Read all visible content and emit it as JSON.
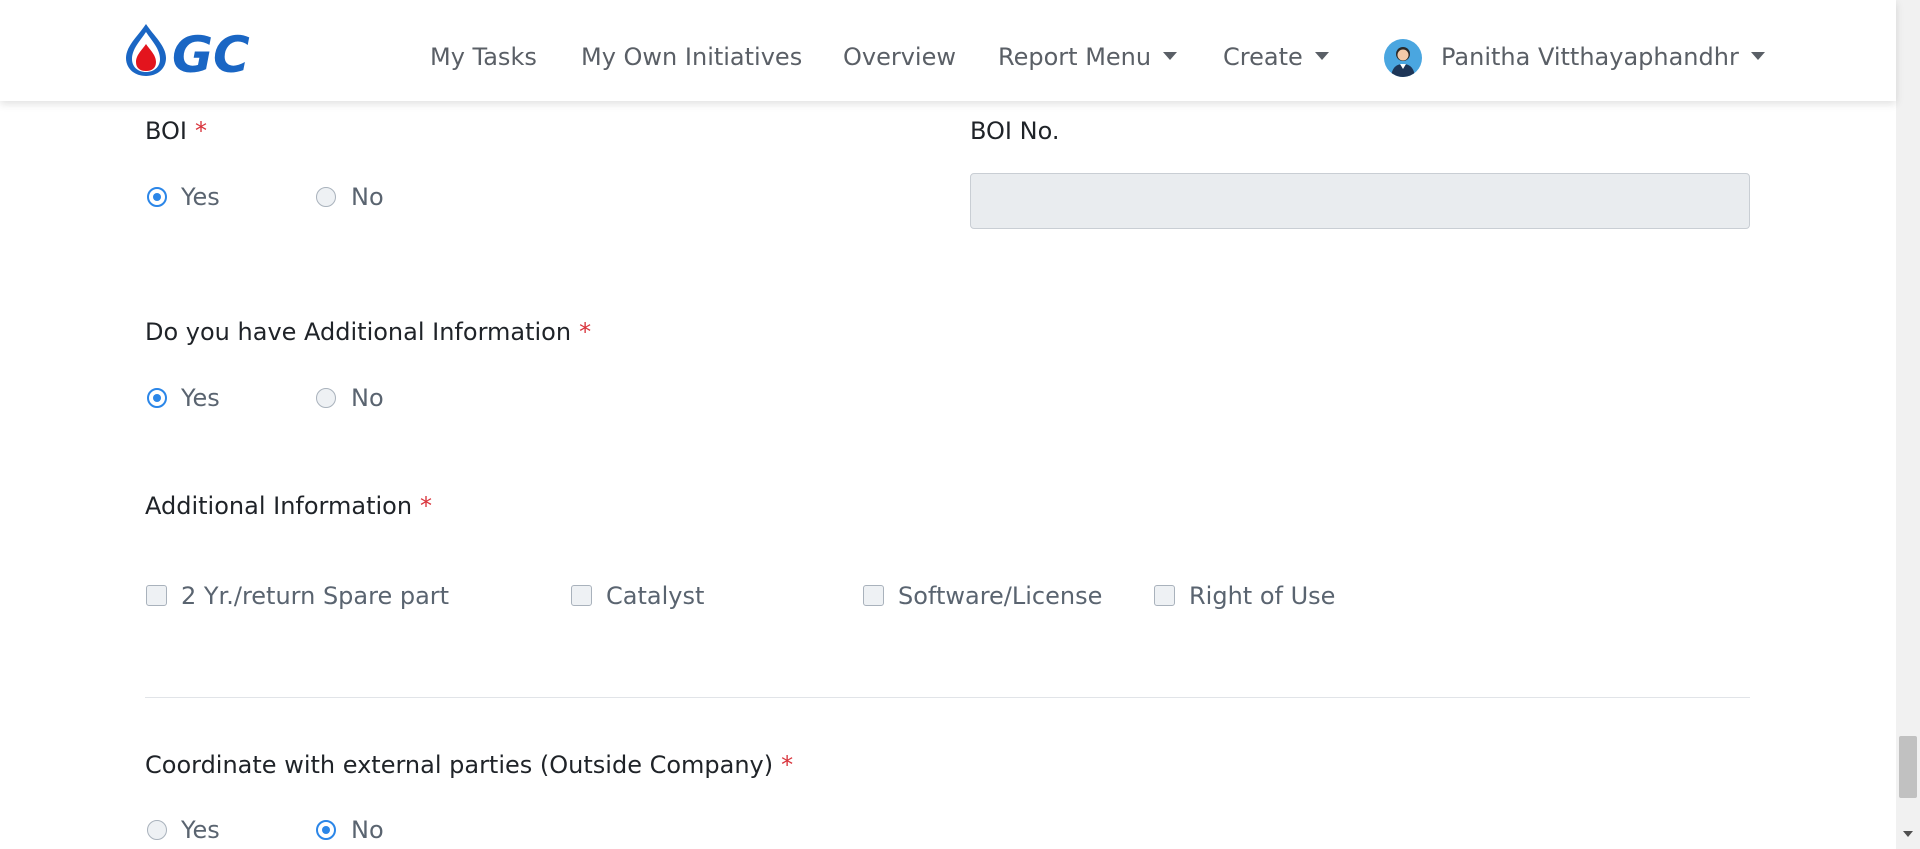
{
  "brand": {
    "logo_text": "GC",
    "logo_color": "#1a66c4",
    "drop_color": "#e3141d"
  },
  "nav": {
    "items": [
      "My Tasks",
      "My Own Initiatives",
      "Overview",
      "Report Menu",
      "Create"
    ],
    "user_name": "Panitha Vitthayaphandhr"
  },
  "form": {
    "required_mark": "*",
    "boi": {
      "label": "BOI",
      "options": [
        "Yes",
        "No"
      ],
      "selected": "Yes"
    },
    "boi_no": {
      "label": "BOI No.",
      "value": ""
    },
    "has_additional": {
      "label": "Do you have Additional Information",
      "options": [
        "Yes",
        "No"
      ],
      "selected": "Yes"
    },
    "additional_info": {
      "label": "Additional Information",
      "options": [
        "2 Yr./return Spare part",
        "Catalyst",
        "Software/License",
        "Right of Use"
      ]
    },
    "coordinate": {
      "label": "Coordinate with external parties (Outside Company)",
      "options": [
        "Yes",
        "No"
      ],
      "selected": "No"
    }
  },
  "colors": {
    "accent": "#2b86e8",
    "required": "#d9343c"
  }
}
